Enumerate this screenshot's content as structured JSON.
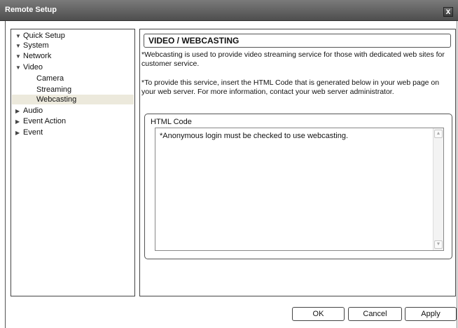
{
  "window": {
    "title": "Remote Setup",
    "close_label": "x"
  },
  "sidebar": {
    "items": [
      {
        "label": "Quick Setup",
        "arrow": "▼"
      },
      {
        "label": "System",
        "arrow": "▼"
      },
      {
        "label": "Network",
        "arrow": "▼"
      },
      {
        "label": "Video",
        "arrow": "▼"
      },
      {
        "label": "Camera",
        "arrow": ""
      },
      {
        "label": "Streaming",
        "arrow": ""
      },
      {
        "label": "Webcasting",
        "arrow": "",
        "selected": true
      },
      {
        "label": "Audio",
        "arrow": "▶"
      },
      {
        "label": "Event Action",
        "arrow": "▶"
      },
      {
        "label": "Event",
        "arrow": "▶"
      }
    ]
  },
  "main": {
    "section_title": "VIDEO / WEBCASTING",
    "description_1": "*Webcasting is used to provide video streaming service for those with dedicated web sites for customer service.",
    "description_2": "*To provide this service, insert the HTML Code that is generated  below in your web page on your web server. For more information, contact your web server administrator.",
    "code_group_label": "HTML Code",
    "code_text": "*Anonymous login must be checked to use webcasting."
  },
  "buttons": {
    "ok": "OK",
    "cancel": "Cancel",
    "apply": "Apply"
  },
  "colors": {
    "selection_bg": "#ece9dc",
    "titlebar": "#5e5e5e"
  }
}
